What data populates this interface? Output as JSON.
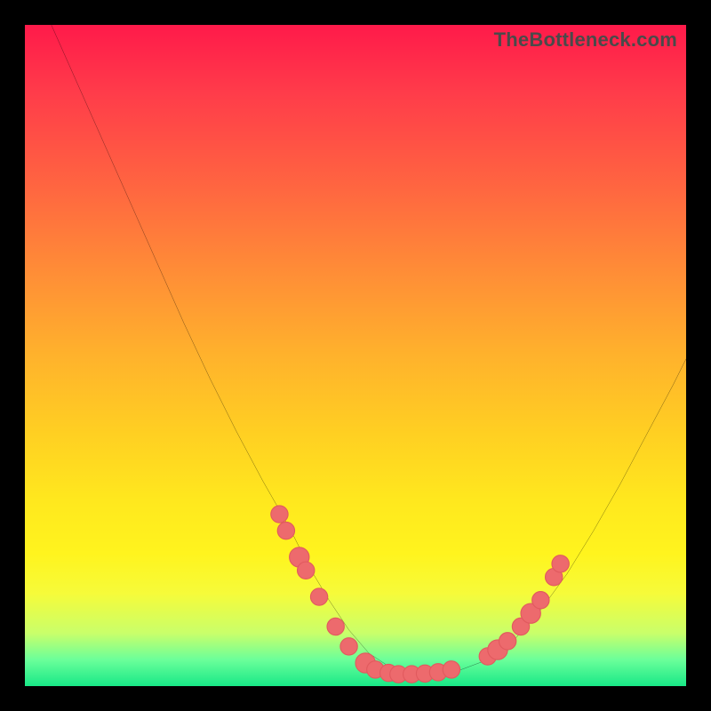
{
  "watermark": "TheBottleneck.com",
  "colors": {
    "frame": "#000000",
    "curve": "#000000",
    "marker_fill": "#ed6a6d",
    "marker_stroke": "#e15a5e"
  },
  "chart_data": {
    "type": "line",
    "title": "",
    "xlabel": "",
    "ylabel": "",
    "xlim": [
      0,
      100
    ],
    "ylim": [
      0,
      100
    ],
    "grid": false,
    "legend": false,
    "series": [
      {
        "name": "bottleneck-curve",
        "x": [
          0,
          4,
          8,
          12,
          16,
          20,
          24,
          28,
          32,
          36,
          40,
          43,
          46,
          49,
          52,
          55,
          58,
          62,
          66,
          70,
          74,
          78,
          82,
          86,
          90,
          94,
          98,
          100
        ],
        "y": [
          109,
          100,
          91,
          82,
          73,
          64,
          55,
          46.5,
          38.5,
          31,
          24,
          18,
          13,
          8.5,
          5,
          3,
          2,
          2,
          2.5,
          4,
          7,
          11.5,
          17,
          23.5,
          30.5,
          38,
          45.5,
          49.5
        ]
      }
    ],
    "markers": [
      {
        "x": 38.5,
        "y": 26.0,
        "r": 1.3
      },
      {
        "x": 39.5,
        "y": 23.5,
        "r": 1.3
      },
      {
        "x": 41.5,
        "y": 19.5,
        "r": 1.5
      },
      {
        "x": 42.5,
        "y": 17.5,
        "r": 1.3
      },
      {
        "x": 44.5,
        "y": 13.5,
        "r": 1.3
      },
      {
        "x": 47.0,
        "y": 9.0,
        "r": 1.3
      },
      {
        "x": 49.0,
        "y": 6.0,
        "r": 1.3
      },
      {
        "x": 51.5,
        "y": 3.5,
        "r": 1.5
      },
      {
        "x": 53.0,
        "y": 2.5,
        "r": 1.3
      },
      {
        "x": 55.0,
        "y": 2.0,
        "r": 1.3
      },
      {
        "x": 56.5,
        "y": 1.8,
        "r": 1.3
      },
      {
        "x": 58.5,
        "y": 1.8,
        "r": 1.3
      },
      {
        "x": 60.5,
        "y": 1.9,
        "r": 1.3
      },
      {
        "x": 62.5,
        "y": 2.1,
        "r": 1.3
      },
      {
        "x": 64.5,
        "y": 2.5,
        "r": 1.3
      },
      {
        "x": 70.0,
        "y": 4.5,
        "r": 1.3
      },
      {
        "x": 71.5,
        "y": 5.5,
        "r": 1.5
      },
      {
        "x": 73.0,
        "y": 6.8,
        "r": 1.3
      },
      {
        "x": 75.0,
        "y": 9.0,
        "r": 1.3
      },
      {
        "x": 76.5,
        "y": 11.0,
        "r": 1.5
      },
      {
        "x": 78.0,
        "y": 13.0,
        "r": 1.3
      },
      {
        "x": 80.0,
        "y": 16.5,
        "r": 1.3
      },
      {
        "x": 81.0,
        "y": 18.5,
        "r": 1.3
      }
    ]
  }
}
